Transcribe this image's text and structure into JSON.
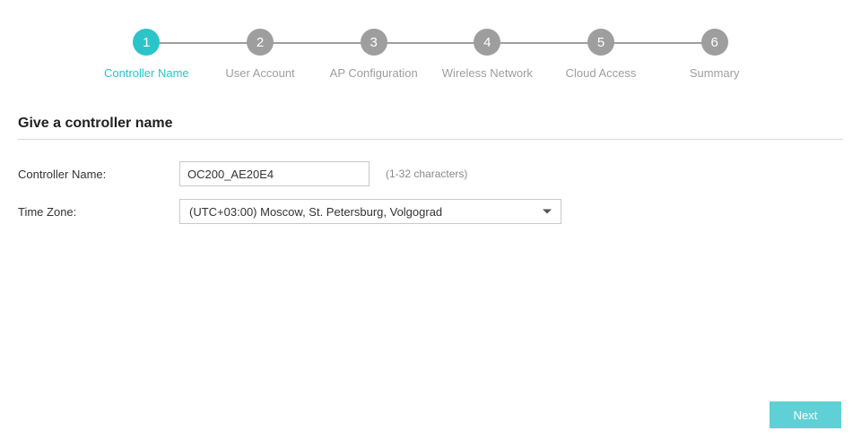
{
  "stepper": {
    "steps": [
      {
        "num": "1",
        "label": "Controller Name",
        "active": true
      },
      {
        "num": "2",
        "label": "User Account",
        "active": false
      },
      {
        "num": "3",
        "label": "AP Configuration",
        "active": false
      },
      {
        "num": "4",
        "label": "Wireless Network",
        "active": false
      },
      {
        "num": "5",
        "label": "Cloud Access",
        "active": false
      },
      {
        "num": "6",
        "label": "Summary",
        "active": false
      }
    ]
  },
  "section": {
    "title": "Give a controller name"
  },
  "form": {
    "controller_name": {
      "label": "Controller Name:",
      "value": "OC200_AE20E4",
      "hint": "(1-32 characters)"
    },
    "time_zone": {
      "label": "Time Zone:",
      "selected": "(UTC+03:00) Moscow, St. Petersburg, Volgograd"
    }
  },
  "footer": {
    "next_label": "Next"
  },
  "colors": {
    "accent": "#2bc4c9",
    "inactive": "#9e9e9e",
    "button": "#5fd1d6"
  }
}
